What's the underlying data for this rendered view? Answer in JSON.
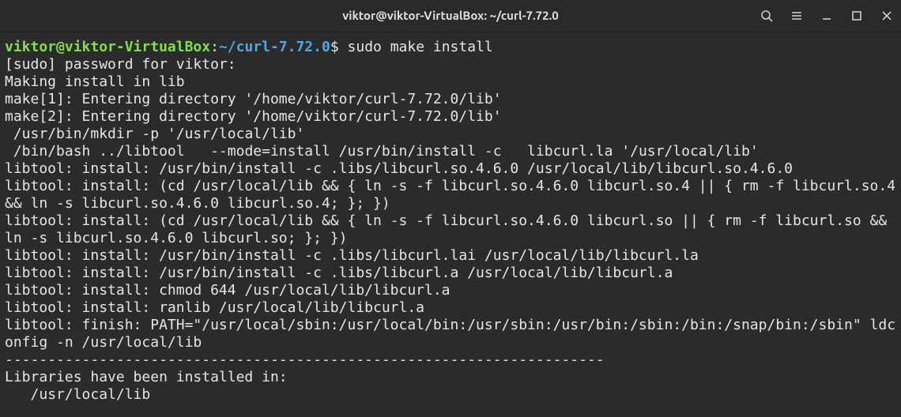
{
  "window": {
    "title": "viktor@viktor-VirtualBox: ~/curl-7.72.0"
  },
  "prompt": {
    "user_host": "viktor@viktor-VirtualBox",
    "colon": ":",
    "path": "~/curl-7.72.0",
    "sigil": "$"
  },
  "command": "sudo make install",
  "output_lines": [
    "[sudo] password for viktor:",
    "Making install in lib",
    "make[1]: Entering directory '/home/viktor/curl-7.72.0/lib'",
    "make[2]: Entering directory '/home/viktor/curl-7.72.0/lib'",
    " /usr/bin/mkdir -p '/usr/local/lib'",
    " /bin/bash ../libtool   --mode=install /usr/bin/install -c   libcurl.la '/usr/local/lib'",
    "libtool: install: /usr/bin/install -c .libs/libcurl.so.4.6.0 /usr/local/lib/libcurl.so.4.6.0",
    "libtool: install: (cd /usr/local/lib && { ln -s -f libcurl.so.4.6.0 libcurl.so.4 || { rm -f libcurl.so.4 && ln -s libcurl.so.4.6.0 libcurl.so.4; }; })",
    "libtool: install: (cd /usr/local/lib && { ln -s -f libcurl.so.4.6.0 libcurl.so || { rm -f libcurl.so && ln -s libcurl.so.4.6.0 libcurl.so; }; })",
    "libtool: install: /usr/bin/install -c .libs/libcurl.lai /usr/local/lib/libcurl.la",
    "libtool: install: /usr/bin/install -c .libs/libcurl.a /usr/local/lib/libcurl.a",
    "libtool: install: chmod 644 /usr/local/lib/libcurl.a",
    "libtool: install: ranlib /usr/local/lib/libcurl.a",
    "libtool: finish: PATH=\"/usr/local/sbin:/usr/local/bin:/usr/sbin:/usr/bin:/sbin:/bin:/snap/bin:/sbin\" ldconfig -n /usr/local/lib",
    "----------------------------------------------------------------------",
    "Libraries have been installed in:",
    "   /usr/local/lib"
  ]
}
